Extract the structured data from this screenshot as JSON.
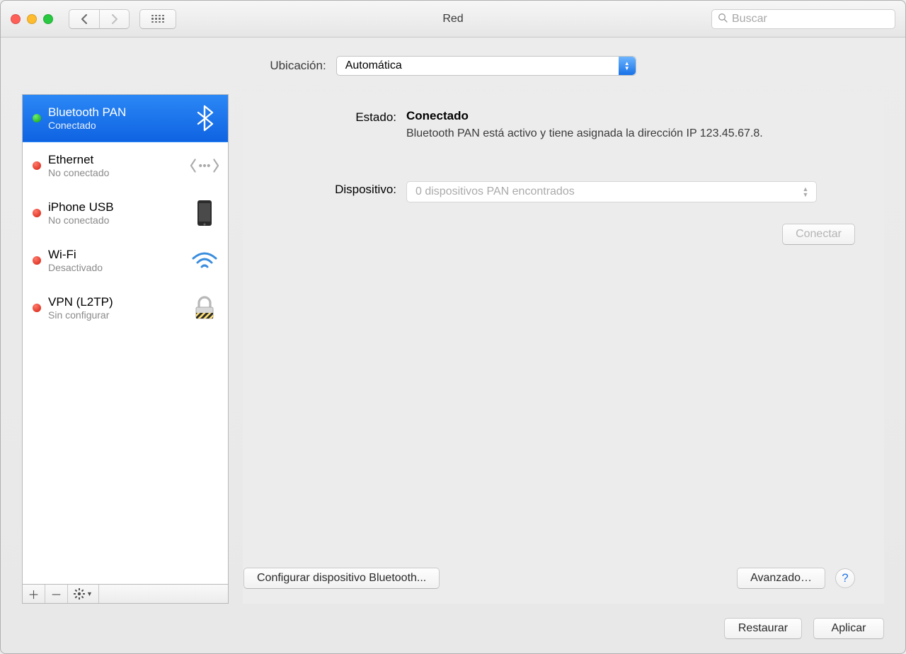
{
  "window": {
    "title": "Red",
    "search_placeholder": "Buscar"
  },
  "location": {
    "label": "Ubicación:",
    "value": "Automática"
  },
  "services": [
    {
      "name": "Bluetooth PAN",
      "status": "Conectado",
      "color": "green",
      "icon": "bluetooth"
    },
    {
      "name": "Ethernet",
      "status": "No conectado",
      "color": "red",
      "icon": "ethernet"
    },
    {
      "name": "iPhone USB",
      "status": "No conectado",
      "color": "red",
      "icon": "iphone"
    },
    {
      "name": "Wi-Fi",
      "status": "Desactivado",
      "color": "red",
      "icon": "wifi"
    },
    {
      "name": "VPN (L2TP)",
      "status": "Sin configurar",
      "color": "red",
      "icon": "lock"
    }
  ],
  "detail": {
    "state_label": "Estado:",
    "state_value": "Conectado",
    "state_desc": "Bluetooth PAN está activo y tiene asignada la dirección IP 123.45.67.8.",
    "device_label": "Dispositivo:",
    "device_value": "0 dispositivos PAN encontrados",
    "connect_btn": "Conectar",
    "config_btn": "Configurar dispositivo Bluetooth...",
    "advanced_btn": "Avanzado…"
  },
  "footer": {
    "revert": "Restaurar",
    "apply": "Aplicar"
  }
}
